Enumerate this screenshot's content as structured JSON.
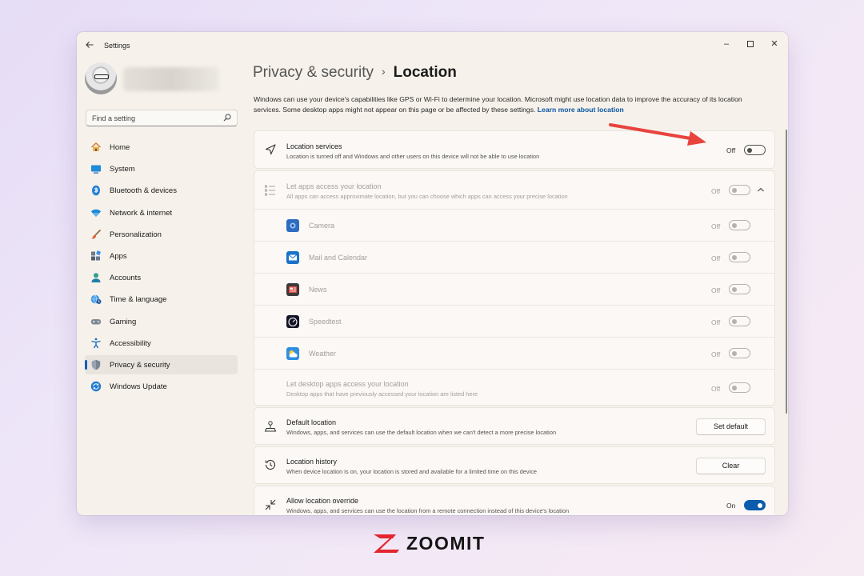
{
  "app": {
    "title": "Settings"
  },
  "window_controls": {
    "minimize": "–",
    "close": "✕"
  },
  "search": {
    "placeholder": "Find a setting"
  },
  "sidebar": {
    "items": [
      {
        "label": "Home",
        "icon": "home-icon"
      },
      {
        "label": "System",
        "icon": "system-icon"
      },
      {
        "label": "Bluetooth & devices",
        "icon": "bluetooth-icon"
      },
      {
        "label": "Network & internet",
        "icon": "wifi-icon"
      },
      {
        "label": "Personalization",
        "icon": "brush-icon"
      },
      {
        "label": "Apps",
        "icon": "apps-icon"
      },
      {
        "label": "Accounts",
        "icon": "accounts-icon"
      },
      {
        "label": "Time & language",
        "icon": "globe-clock-icon"
      },
      {
        "label": "Gaming",
        "icon": "gamepad-icon"
      },
      {
        "label": "Accessibility",
        "icon": "accessibility-icon"
      },
      {
        "label": "Privacy & security",
        "icon": "shield-icon",
        "active": true
      },
      {
        "label": "Windows Update",
        "icon": "update-icon"
      }
    ]
  },
  "breadcrumb": {
    "parent": "Privacy & security",
    "separator": "›",
    "current": "Location"
  },
  "description": {
    "text": "Windows can use your device's capabilities like GPS or Wi-Fi to determine your location. Microsoft might use location data to improve the accuracy of its location services. Some desktop apps might not appear on this page or be affected by these settings.",
    "link": "Learn more about location"
  },
  "location_services": {
    "title": "Location services",
    "subtitle": "Location is turned off and Windows and other users on this device will not be able to use location",
    "state": "Off"
  },
  "let_apps": {
    "title": "Let apps access your location",
    "subtitle": "All apps can access approximate location, but you can choose which apps can access your precise location",
    "state": "Off",
    "apps": [
      {
        "name": "Camera",
        "state": "Off",
        "icon": "camera-app-icon"
      },
      {
        "name": "Mail and Calendar",
        "state": "Off",
        "icon": "mail-app-icon"
      },
      {
        "name": "News",
        "state": "Off",
        "icon": "news-app-icon"
      },
      {
        "name": "Speedtest",
        "state": "Off",
        "icon": "speedtest-app-icon"
      },
      {
        "name": "Weather",
        "state": "Off",
        "icon": "weather-app-icon"
      }
    ],
    "desktop": {
      "title": "Let desktop apps access your location",
      "subtitle": "Desktop apps that have previously accessed your location are listed here",
      "state": "Off"
    }
  },
  "default_location": {
    "title": "Default location",
    "subtitle": "Windows, apps, and services can use the default location when we can't detect a more precise location",
    "button": "Set default"
  },
  "location_history": {
    "title": "Location history",
    "subtitle": "When device location is on, your location is stored and available for a limited time on this device",
    "button": "Clear"
  },
  "override": {
    "title": "Allow location override",
    "subtitle": "Windows, apps, and services can use the location from a remote connection instead of this device's location",
    "state": "On"
  },
  "watermark": {
    "brand": "ZOOMIT"
  },
  "colors": {
    "accent": "#005fb8",
    "toggle_on": "#0b5cad",
    "annotation_arrow": "#e8433e",
    "logo_red": "#e3262f"
  }
}
